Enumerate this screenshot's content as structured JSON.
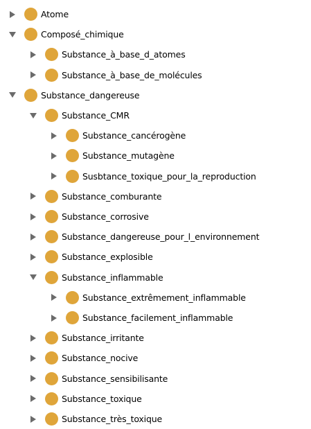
{
  "tree": {
    "dot_color": "#dfa53a",
    "toggle_color": "#6b6b6b",
    "nodes": [
      {
        "label": "Atome",
        "level": 0,
        "state": "collapsed",
        "slug": "atome"
      },
      {
        "label": "Composé_chimique",
        "level": 0,
        "state": "expanded",
        "slug": "compose-chimique"
      },
      {
        "label": "Substance_à_base_d_atomes",
        "level": 1,
        "state": "collapsed",
        "slug": "substance-a-base-d-atomes"
      },
      {
        "label": "Substance_à_base_de_molécules",
        "level": 1,
        "state": "collapsed",
        "slug": "substance-a-base-de-molecules"
      },
      {
        "label": "Substance_dangereuse",
        "level": 0,
        "state": "expanded",
        "slug": "substance-dangereuse"
      },
      {
        "label": "Substance_CMR",
        "level": 1,
        "state": "expanded",
        "slug": "substance-cmr"
      },
      {
        "label": "Substance_cancérogène",
        "level": 2,
        "state": "collapsed",
        "slug": "substance-cancerogene"
      },
      {
        "label": "Substance_mutagène",
        "level": 2,
        "state": "collapsed",
        "slug": "substance-mutagene"
      },
      {
        "label": "Susbtance_toxique_pour_la_reproduction",
        "level": 2,
        "state": "collapsed",
        "slug": "susbtance-toxique-pour-la-reproduction"
      },
      {
        "label": "Substance_comburante",
        "level": 1,
        "state": "collapsed",
        "slug": "substance-comburante"
      },
      {
        "label": "Substance_corrosive",
        "level": 1,
        "state": "collapsed",
        "slug": "substance-corrosive"
      },
      {
        "label": "Substance_dangereuse_pour_l_environnement",
        "level": 1,
        "state": "collapsed",
        "slug": "substance-dangereuse-pour-l-environnement"
      },
      {
        "label": "Substance_explosible",
        "level": 1,
        "state": "collapsed",
        "slug": "substance-explosible"
      },
      {
        "label": "Substance_inflammable",
        "level": 1,
        "state": "expanded",
        "slug": "substance-inflammable"
      },
      {
        "label": "Substance_extrêmement_inflammable",
        "level": 2,
        "state": "collapsed",
        "slug": "substance-extremement-inflammable"
      },
      {
        "label": "Substance_facilement_inflammable",
        "level": 2,
        "state": "collapsed",
        "slug": "substance-facilement-inflammable"
      },
      {
        "label": "Substance_irritante",
        "level": 1,
        "state": "collapsed",
        "slug": "substance-irritante"
      },
      {
        "label": "Substance_nocive",
        "level": 1,
        "state": "collapsed",
        "slug": "substance-nocive"
      },
      {
        "label": "Substance_sensibilisante",
        "level": 1,
        "state": "collapsed",
        "slug": "substance-sensibilisante"
      },
      {
        "label": "Substance_toxique",
        "level": 1,
        "state": "collapsed",
        "slug": "substance-toxique"
      },
      {
        "label": "Substance_très_toxique",
        "level": 1,
        "state": "collapsed",
        "slug": "substance-tres-toxique"
      }
    ]
  }
}
